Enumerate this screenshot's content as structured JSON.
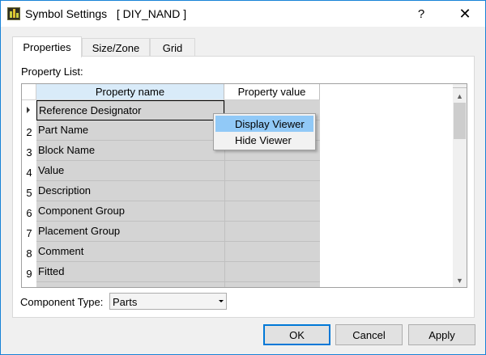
{
  "window": {
    "title": "Symbol Settings   [ DIY_NAND ]",
    "help_label": "?",
    "close_label": "✕"
  },
  "tabs": [
    {
      "label": "Properties",
      "active": true
    },
    {
      "label": "Size/Zone",
      "active": false
    },
    {
      "label": "Grid",
      "active": false
    }
  ],
  "property_list": {
    "label": "Property List:",
    "columns": [
      "Property name",
      "Property value"
    ],
    "rows": [
      {
        "num": "",
        "name": "Reference Designator",
        "value": ""
      },
      {
        "num": "2",
        "name": "Part Name",
        "value": ""
      },
      {
        "num": "3",
        "name": "Block Name",
        "value": ""
      },
      {
        "num": "4",
        "name": "Value",
        "value": ""
      },
      {
        "num": "5",
        "name": "Description",
        "value": ""
      },
      {
        "num": "6",
        "name": "Component Group",
        "value": ""
      },
      {
        "num": "7",
        "name": "Placement Group",
        "value": ""
      },
      {
        "num": "8",
        "name": "Comment",
        "value": ""
      },
      {
        "num": "9",
        "name": "Fitted",
        "value": ""
      },
      {
        "num": "",
        "name": "",
        "value": ""
      }
    ]
  },
  "context_menu": {
    "items": [
      "Display Viewer",
      "Hide Viewer"
    ]
  },
  "component_type": {
    "label": "Component Type:",
    "value": "Parts"
  },
  "buttons": {
    "ok": "OK",
    "cancel": "Cancel",
    "apply": "Apply"
  }
}
